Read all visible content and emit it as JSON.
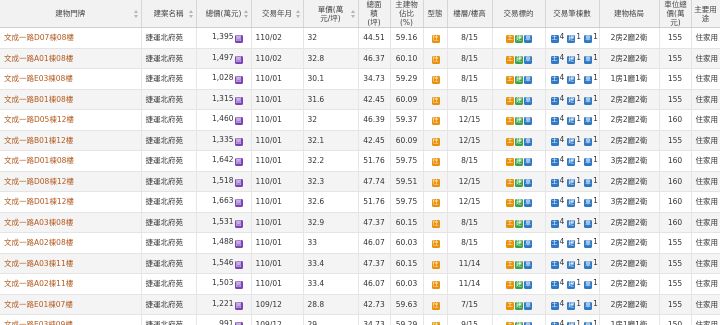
{
  "table": {
    "headers": {
      "address": "建物門牌",
      "community": "建案名稱",
      "total_price": "總價(萬元)",
      "trade_date": "交易年月",
      "unit_price": "單價(萬元/坪)",
      "total_area": "總面積(坪)",
      "main_ratio": "主建物佔比(%)",
      "type": "型態",
      "floor": "樓層/樓高",
      "trade_target": "交易標的",
      "trade_count": "交易筆棟數",
      "layout": "建物格局",
      "parking_price": "車位總價(萬元)",
      "usage": "主要用途"
    },
    "rows": [
      {
        "address": "文成一路D07棟08樓",
        "community": "捷運北府苑",
        "total_price": "1,395",
        "trade_date": "110/02",
        "unit_price": "32",
        "total_area": "44.51",
        "main_ratio": "59.16",
        "floor": "8/15",
        "layout": "2房2廳2衛",
        "parking_price": "155",
        "usage": "住家用"
      },
      {
        "address": "文成一路A01棟08樓",
        "community": "捷運北府苑",
        "total_price": "1,497",
        "trade_date": "110/02",
        "unit_price": "32.8",
        "total_area": "46.37",
        "main_ratio": "60.10",
        "floor": "8/15",
        "layout": "2房2廳2衛",
        "parking_price": "155",
        "usage": "住家用"
      },
      {
        "address": "文成一路E03棟08樓",
        "community": "捷運北府苑",
        "total_price": "1,028",
        "trade_date": "110/01",
        "unit_price": "30.1",
        "total_area": "34.73",
        "main_ratio": "59.29",
        "floor": "8/15",
        "layout": "1房1廳1衛",
        "parking_price": "155",
        "usage": "住家用"
      },
      {
        "address": "文成一路B01棟08樓",
        "community": "捷運北府苑",
        "total_price": "1,315",
        "trade_date": "110/01",
        "unit_price": "31.6",
        "total_area": "42.45",
        "main_ratio": "60.09",
        "floor": "8/15",
        "layout": "2房2廳2衛",
        "parking_price": "155",
        "usage": "住家用"
      },
      {
        "address": "文成一路D05棟12樓",
        "community": "捷運北府苑",
        "total_price": "1,460",
        "trade_date": "110/01",
        "unit_price": "32",
        "total_area": "46.39",
        "main_ratio": "59.37",
        "floor": "12/15",
        "layout": "2房2廳2衛",
        "parking_price": "160",
        "usage": "住家用"
      },
      {
        "address": "文成一路B01棟12樓",
        "community": "捷運北府苑",
        "total_price": "1,335",
        "trade_date": "110/01",
        "unit_price": "32.1",
        "total_area": "42.45",
        "main_ratio": "60.09",
        "floor": "12/15",
        "layout": "2房2廳2衛",
        "parking_price": "155",
        "usage": "住家用"
      },
      {
        "address": "文成一路D01棟08樓",
        "community": "捷運北府苑",
        "total_price": "1,642",
        "trade_date": "110/01",
        "unit_price": "32.2",
        "total_area": "51.76",
        "main_ratio": "59.75",
        "floor": "8/15",
        "layout": "3房2廳2衛",
        "parking_price": "160",
        "usage": "住家用"
      },
      {
        "address": "文成一路D08棟12樓",
        "community": "捷運北府苑",
        "total_price": "1,518",
        "trade_date": "110/01",
        "unit_price": "32.3",
        "total_area": "47.74",
        "main_ratio": "59.51",
        "floor": "12/15",
        "layout": "2房2廳2衛",
        "parking_price": "160",
        "usage": "住家用"
      },
      {
        "address": "文成一路D01棟12樓",
        "community": "捷運北府苑",
        "total_price": "1,663",
        "trade_date": "110/01",
        "unit_price": "32.6",
        "total_area": "51.76",
        "main_ratio": "59.75",
        "floor": "12/15",
        "layout": "3房2廳2衛",
        "parking_price": "160",
        "usage": "住家用"
      },
      {
        "address": "文成一路A03棟08樓",
        "community": "捷運北府苑",
        "total_price": "1,531",
        "trade_date": "110/01",
        "unit_price": "32.9",
        "total_area": "47.37",
        "main_ratio": "60.15",
        "floor": "8/15",
        "layout": "2房2廳2衛",
        "parking_price": "160",
        "usage": "住家用"
      },
      {
        "address": "文成一路A02棟08樓",
        "community": "捷運北府苑",
        "total_price": "1,488",
        "trade_date": "110/01",
        "unit_price": "33",
        "total_area": "46.07",
        "main_ratio": "60.03",
        "floor": "8/15",
        "layout": "2房2廳2衛",
        "parking_price": "155",
        "usage": "住家用"
      },
      {
        "address": "文成一路A03棟11樓",
        "community": "捷運北府苑",
        "total_price": "1,546",
        "trade_date": "110/01",
        "unit_price": "33.4",
        "total_area": "47.37",
        "main_ratio": "60.15",
        "floor": "11/14",
        "layout": "2房2廳2衛",
        "parking_price": "155",
        "usage": "住家用"
      },
      {
        "address": "文成一路A02棟11樓",
        "community": "捷運北府苑",
        "total_price": "1,503",
        "trade_date": "110/01",
        "unit_price": "33.4",
        "total_area": "46.07",
        "main_ratio": "60.03",
        "floor": "11/14",
        "layout": "2房2廳2衛",
        "parking_price": "155",
        "usage": "住家用"
      },
      {
        "address": "文成一路E01棟07樓",
        "community": "捷運北府苑",
        "total_price": "1,221",
        "trade_date": "109/12",
        "unit_price": "28.8",
        "total_area": "42.73",
        "main_ratio": "59.63",
        "floor": "7/15",
        "layout": "2房2廳2衛",
        "parking_price": "155",
        "usage": "住家用"
      },
      {
        "address": "文成一路E03棟09樓",
        "community": "捷運北府苑",
        "total_price": "991",
        "trade_date": "109/12",
        "unit_price": "29",
        "total_area": "34.73",
        "main_ratio": "59.29",
        "floor": "9/15",
        "layout": "1房1廳1衛",
        "parking_price": "150",
        "usage": "住家用"
      }
    ]
  },
  "badges": {
    "total_price_tag": "圖",
    "type_tag": "住",
    "target_tags": [
      "土",
      "建",
      "車"
    ],
    "count_tags": [
      "土",
      "建",
      "車"
    ],
    "count_values": [
      "4",
      "1",
      "1"
    ]
  },
  "colors": {
    "link": "#b35a1f",
    "purple": "#7a43b6",
    "orange": "#e8900c",
    "green": "#3aa34a",
    "blue": "#2f78c4"
  }
}
